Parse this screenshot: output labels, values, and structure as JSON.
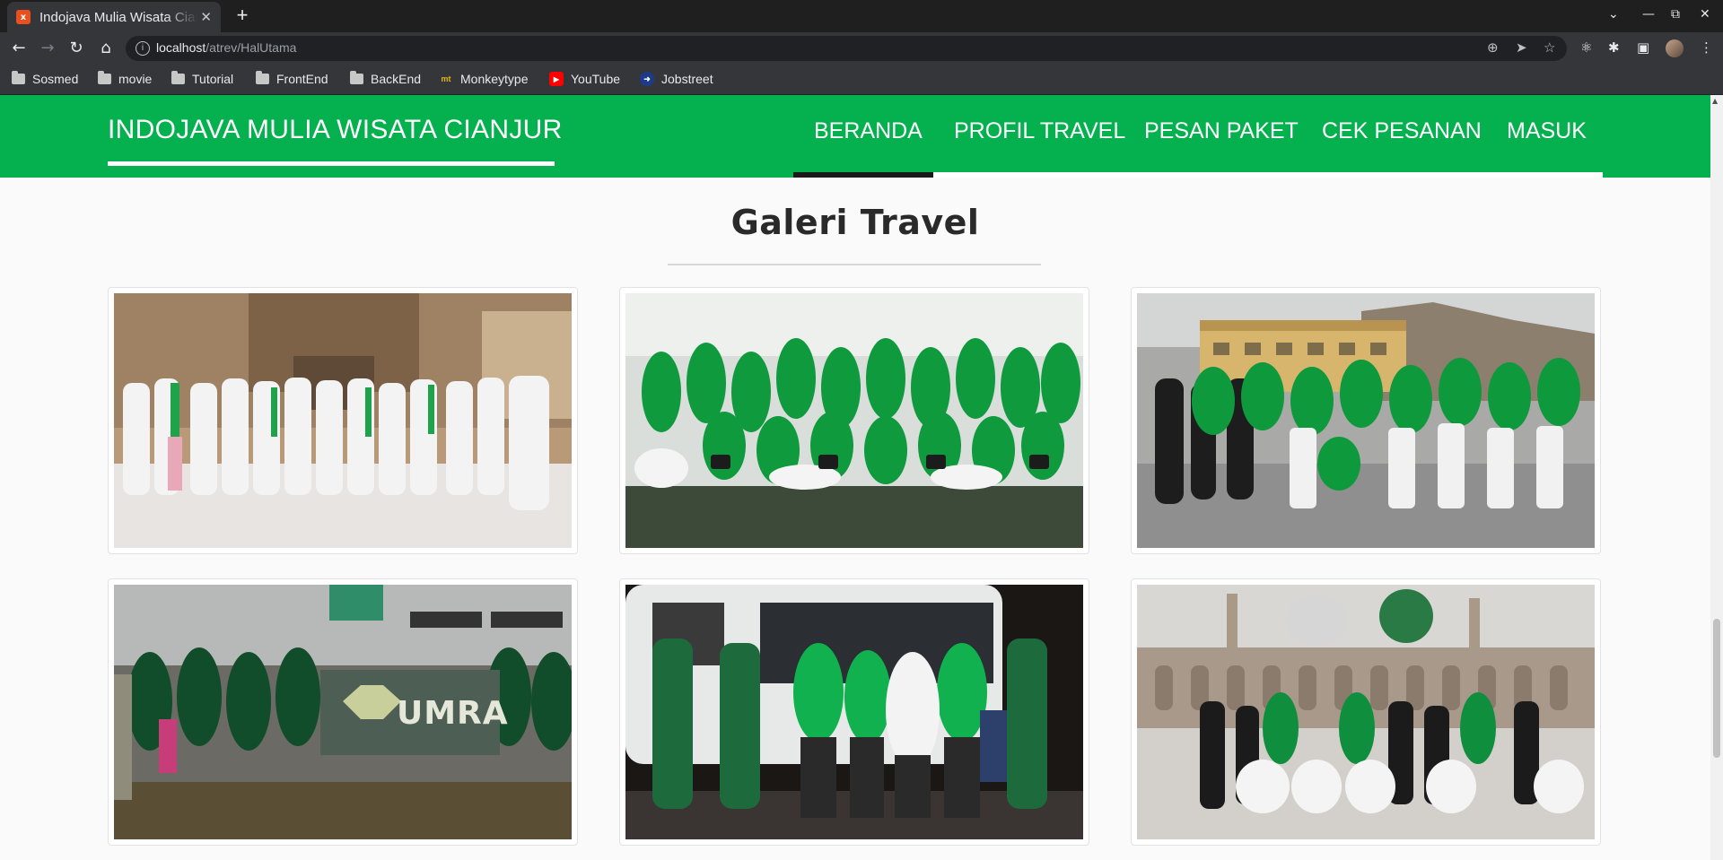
{
  "browser": {
    "tab_title": "Indojava Mulia Wisata Cianjur",
    "url_host": "localhost",
    "url_path": "/atrev/HalUtama",
    "bookmarks": [
      "Sosmed",
      "movie",
      "Tutorial",
      "FrontEnd",
      "BackEnd",
      "Monkeytype",
      "YouTube",
      "Jobstreet"
    ]
  },
  "site": {
    "brand": "INDOJAVA MULIA WISATA CIANJUR",
    "menu": [
      "BERANDA",
      "PROFIL TRAVEL",
      "PESAN PAKET",
      "CEK PESANAN",
      "MASUK"
    ],
    "active_menu": "BERANDA",
    "colors": {
      "navbar": "#05b14e",
      "accent": "#1a1a1a"
    }
  },
  "gallery": {
    "title": "Galeri Travel",
    "photos": [
      {
        "scene": "pilgrims-in-white-mosque-door"
      },
      {
        "scene": "pilgrims-in-green-seated-mosque"
      },
      {
        "scene": "pilgrims-at-mountain-building"
      },
      {
        "scene": "airport-group-with-umrah-banner"
      },
      {
        "scene": "group-in-front-of-white-bus"
      },
      {
        "scene": "group-at-nabawi-green-dome"
      }
    ]
  }
}
